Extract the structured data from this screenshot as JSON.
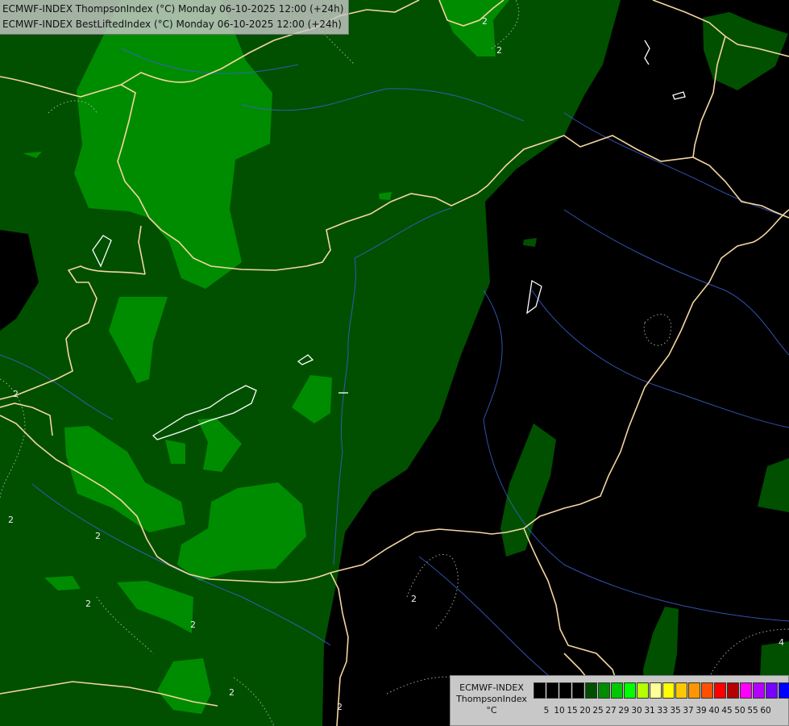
{
  "header": {
    "line1": "ECMWF-INDEX ThompsonIndex (°C) Monday 06-10-2025 12:00 (+24h)",
    "line2": "ECMWF-INDEX BestLiftedIndex (°C) Monday 06-10-2025 12:00 (+24h)"
  },
  "legend": {
    "line1": "ECMWF-INDEX",
    "line2": "ThompsonIndex",
    "unit": "°C",
    "colors": [
      "#000000",
      "#000000",
      "#000000",
      "#000000",
      "#005000",
      "#008c00",
      "#00c800",
      "#00ff00",
      "#b4ff00",
      "#ffff96",
      "#ffff00",
      "#ffc800",
      "#ff9600",
      "#ff5000",
      "#ff0000",
      "#b40000",
      "#ff00ff",
      "#b400ff",
      "#7800ff",
      "#0000ff"
    ],
    "ticks": [
      "5",
      "10",
      "15",
      "20",
      "25",
      "27",
      "29",
      "30",
      "31",
      "33",
      "35",
      "37",
      "39",
      "40",
      "45",
      "50",
      "55",
      "60"
    ]
  },
  "map": {
    "isoline_labels": [
      "2",
      "2",
      "2",
      "2",
      "2",
      "2",
      "2",
      "2",
      "2",
      "2",
      "4"
    ]
  }
}
